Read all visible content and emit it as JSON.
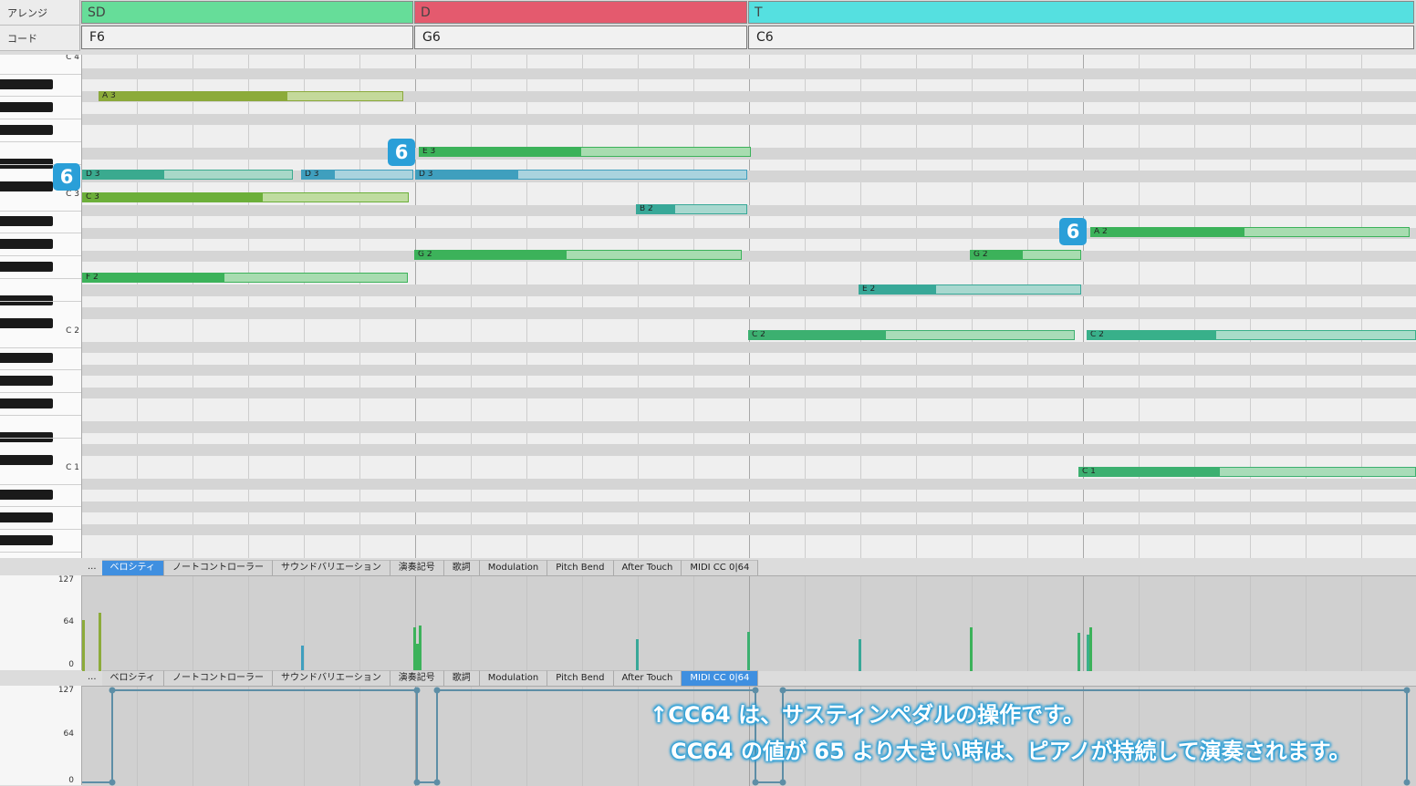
{
  "header": {
    "arrange_label": "アレンジ",
    "chord_label": "コード",
    "sections": [
      {
        "label": "SD",
        "color": "#66dd99"
      },
      {
        "label": "D",
        "color": "#e45a6e"
      },
      {
        "label": "T",
        "color": "#55e0e0"
      }
    ],
    "chords": [
      "F6",
      "G6",
      "C6"
    ]
  },
  "keyboard": {
    "octave_labels": [
      "C 4",
      "C 3",
      "C 2",
      "C 1"
    ]
  },
  "notes": [
    {
      "label": "A 3",
      "color": "olive"
    },
    {
      "label": "D 3",
      "color": "teal"
    },
    {
      "label": "D 3",
      "color": "blue"
    },
    {
      "label": "D 3",
      "color": "blue"
    },
    {
      "label": "E 3",
      "color": "green"
    },
    {
      "label": "C 3",
      "color": "lime"
    },
    {
      "label": "B 2",
      "color": "teal"
    },
    {
      "label": "A 2",
      "color": "green"
    },
    {
      "label": "G 2",
      "color": "green"
    },
    {
      "label": "G 2",
      "color": "green"
    },
    {
      "label": "F 2",
      "color": "green"
    },
    {
      "label": "E 2",
      "color": "teal"
    },
    {
      "label": "C 2",
      "color": "green"
    },
    {
      "label": "C 2",
      "color": "teal"
    },
    {
      "label": "C 1",
      "color": "green"
    }
  ],
  "badges": [
    "6",
    "6",
    "6"
  ],
  "tabs": {
    "more": "...",
    "items": [
      "ベロシティ",
      "ノートコントローラー",
      "サウンドバリエーション",
      "演奏記号",
      "歌詞",
      "Modulation",
      "Pitch Bend",
      "After Touch",
      "MIDI CC 0|64"
    ]
  },
  "panel_scale": [
    "127",
    "64",
    "0"
  ],
  "caption": {
    "line1": "↑CC64 は、サスティンペダルの操作です。",
    "line2": "CC64 の値が 65 より大きい時は、ピアノが持続して演奏されます。"
  },
  "colors": {
    "accent_tab": "#3f8fe0",
    "badge": "#2a9fd8",
    "cc_line": "#5d8ea6"
  }
}
